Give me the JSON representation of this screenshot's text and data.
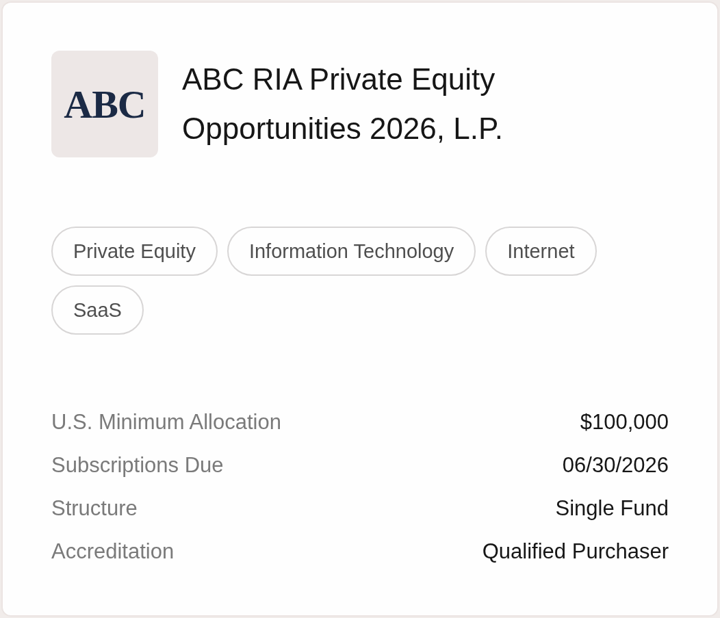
{
  "logo": {
    "text": "ABC"
  },
  "title": "ABC RIA Private Equity Opportunities 2026, L.P.",
  "tags": [
    "Private Equity",
    "Information Technology",
    "Internet",
    "SaaS"
  ],
  "details": [
    {
      "label": "U.S. Minimum Allocation",
      "value": "$100,000"
    },
    {
      "label": "Subscriptions Due",
      "value": "06/30/2026"
    },
    {
      "label": "Structure",
      "value": "Single Fund"
    },
    {
      "label": "Accreditation",
      "value": "Qualified Purchaser"
    }
  ]
}
